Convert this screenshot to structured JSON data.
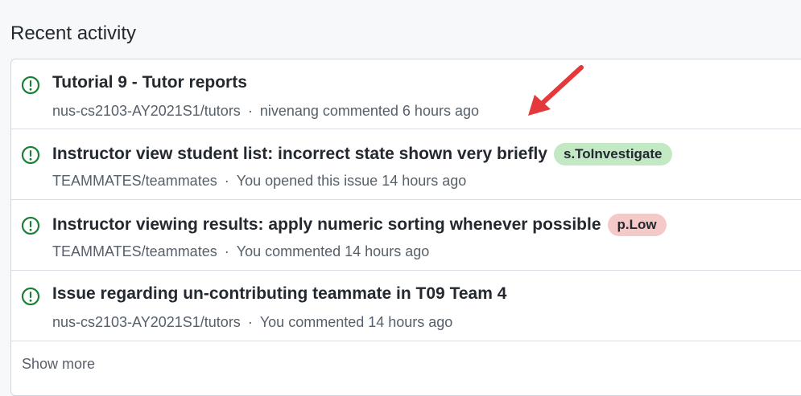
{
  "section": {
    "title": "Recent activity"
  },
  "items": [
    {
      "title": "Tutorial 9 - Tutor reports",
      "repo": "nus-cs2103-AY2021S1/tutors",
      "separator": "·",
      "activity": "nivenang commented 6 hours ago",
      "label": null
    },
    {
      "title": "Instructor view student list: incorrect state shown very briefly",
      "repo": "TEAMMATES/teammates",
      "separator": "·",
      "activity": "You opened this issue 14 hours ago",
      "label": {
        "text": "s.ToInvestigate",
        "color": "#c2e8c4"
      }
    },
    {
      "title": "Instructor viewing results: apply numeric sorting whenever possible",
      "repo": "TEAMMATES/teammates",
      "separator": "·",
      "activity": "You commented 14 hours ago",
      "label": {
        "text": "p.Low",
        "color": "#f6c9c9"
      }
    },
    {
      "title": "Issue regarding un-contributing teammate in T09 Team 4",
      "repo": "nus-cs2103-AY2021S1/tutors",
      "separator": "·",
      "activity": "You commented 14 hours ago",
      "label": null
    }
  ],
  "footer": {
    "show_more": "Show more"
  },
  "colors": {
    "open_issue_icon": "#1a7f37",
    "annotation_arrow": "#e5383b"
  },
  "icons": {
    "issue": "issue-opened-icon",
    "annotation": "red-arrow-annotation"
  }
}
